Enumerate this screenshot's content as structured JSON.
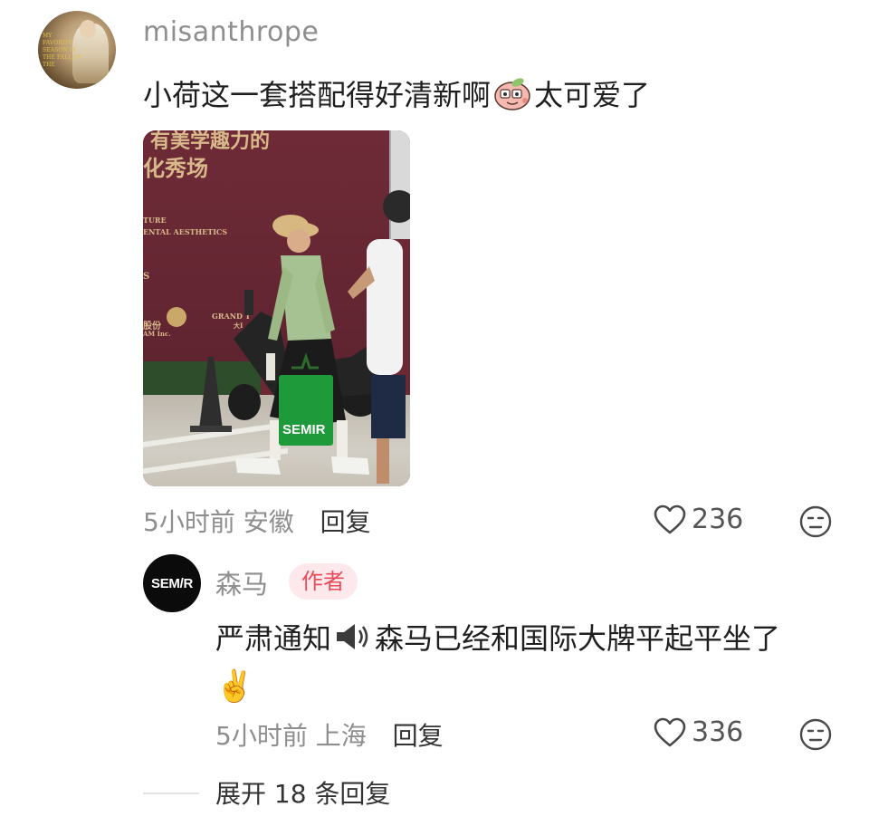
{
  "comments": [
    {
      "username": "misanthrope",
      "avatar_text": "MY FAVORITE SEASON IS THE FALL OF THE",
      "text_before_sticker": "小荷这一套搭配得好清新啊",
      "sticker_icon": "peach-sticker-icon",
      "text_after_sticker": "太可爱了",
      "photo": {
        "wall_text_1": "有美学趣力的",
        "wall_text_2": "化秀场",
        "wall_text_3": "TURE",
        "wall_text_4": "ENTAL AESTHETICS",
        "wall_text_5": "S",
        "wall_text_6": "股份",
        "wall_text_7": "AM Inc.",
        "wall_text_8": "GRAND T",
        "wall_text_9": "大I",
        "bag_text": "SEMIR"
      },
      "time": "5小时前",
      "location": "安徽",
      "reply_label": "回复",
      "likes": "236"
    },
    {
      "username": "森马",
      "avatar_text": "SEM/R",
      "badge": "作者",
      "text_before_icon": "严肃通知",
      "icon": "speaker-icon",
      "text_after_icon": "森马已经和国际大牌平起平坐了",
      "emoji": "✌️",
      "time": "5小时前",
      "location": "上海",
      "reply_label": "回复",
      "likes": "336"
    }
  ],
  "expand_label": "展开 18 条回复",
  "colors": {
    "meta": "#8e8e8e",
    "badge_text": "#e94b5b",
    "badge_bg": "#fde9ec"
  }
}
